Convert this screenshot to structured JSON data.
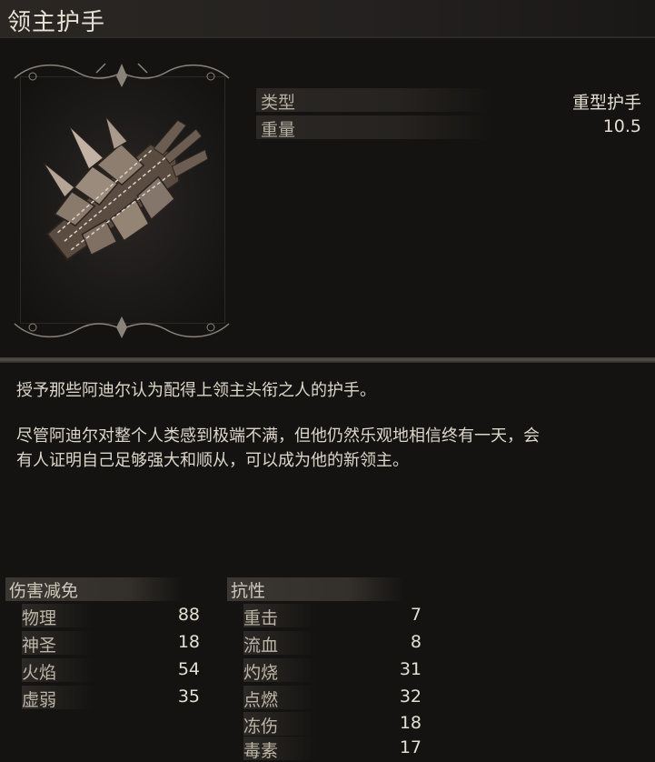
{
  "header": {
    "title": "领主护手"
  },
  "item": {
    "icon": "gauntlet-icon",
    "properties": [
      {
        "label": "类型",
        "value": "重型护手"
      },
      {
        "label": "重量",
        "value": "10.5"
      }
    ]
  },
  "description": {
    "paragraph1": "授予那些阿迪尔认为配得上领主头衔之人的护手。",
    "paragraph2_line1": "尽管阿迪尔对整个人类感到极端不满，但他仍然乐观地相信终有一天，会",
    "paragraph2_line2": "有人证明自己足够强大和顺从，可以成为他的新领主。"
  },
  "damage_reduction": {
    "heading": "伤害减免",
    "rows": [
      {
        "label": "物理",
        "value": "88"
      },
      {
        "label": "神圣",
        "value": "18"
      },
      {
        "label": "火焰",
        "value": "54"
      },
      {
        "label": "虚弱",
        "value": "35"
      }
    ]
  },
  "resistance": {
    "heading": "抗性",
    "rows": [
      {
        "label": "重击",
        "value": "7"
      },
      {
        "label": "流血",
        "value": "8"
      },
      {
        "label": "灼烧",
        "value": "31"
      },
      {
        "label": "点燃",
        "value": "32"
      },
      {
        "label": "冻伤",
        "value": "18"
      },
      {
        "label": "毒素",
        "value": "17"
      }
    ]
  },
  "colors": {
    "background": "#151311",
    "text": "#d6d1c4",
    "muted": "#b4ae9f"
  }
}
